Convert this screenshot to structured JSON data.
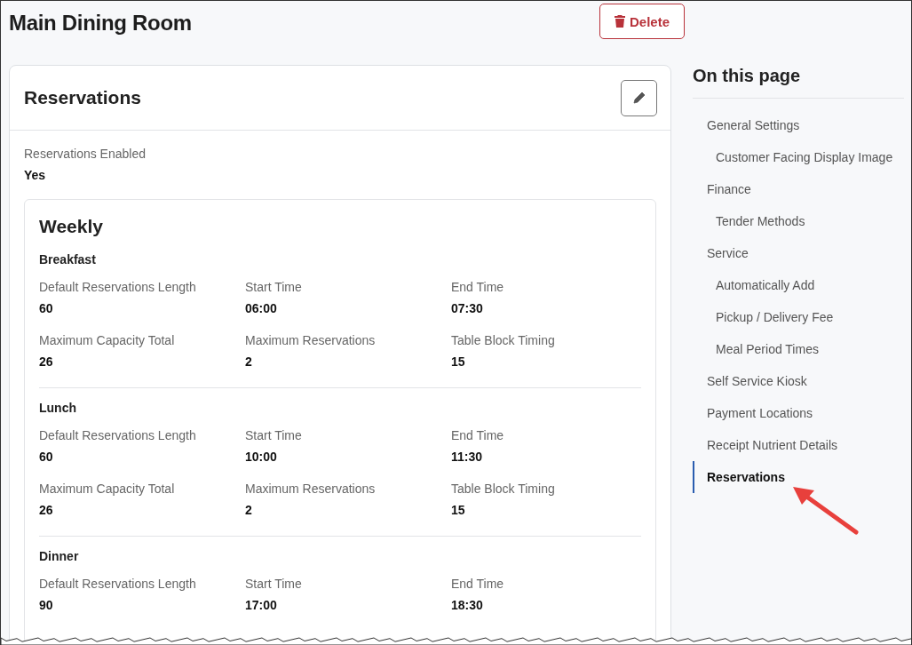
{
  "page": {
    "title": "Main Dining Room",
    "delete_button": "Delete"
  },
  "card": {
    "title": "Reservations",
    "fields": [
      {
        "label": "Reservations Enabled",
        "value": "Yes"
      }
    ],
    "weekly": {
      "title": "Weekly",
      "periods": [
        {
          "name": "Breakfast",
          "fields": [
            {
              "label": "Default Reservations Length",
              "value": "60"
            },
            {
              "label": "Start Time",
              "value": "06:00"
            },
            {
              "label": "End Time",
              "value": "07:30"
            },
            {
              "label": "Maximum Capacity Total",
              "value": "26"
            },
            {
              "label": "Maximum Reservations",
              "value": "2"
            },
            {
              "label": "Table Block Timing",
              "value": "15"
            }
          ]
        },
        {
          "name": "Lunch",
          "fields": [
            {
              "label": "Default Reservations Length",
              "value": "60"
            },
            {
              "label": "Start Time",
              "value": "10:00"
            },
            {
              "label": "End Time",
              "value": "11:30"
            },
            {
              "label": "Maximum Capacity Total",
              "value": "26"
            },
            {
              "label": "Maximum Reservations",
              "value": "2"
            },
            {
              "label": "Table Block Timing",
              "value": "15"
            }
          ]
        },
        {
          "name": "Dinner",
          "fields": [
            {
              "label": "Default Reservations Length",
              "value": "90"
            },
            {
              "label": "Start Time",
              "value": "17:00"
            },
            {
              "label": "End Time",
              "value": "18:30"
            }
          ]
        }
      ]
    }
  },
  "sidebar": {
    "title": "On this page",
    "items": [
      {
        "label": "General Settings",
        "selected": false,
        "children": [
          {
            "label": "Customer Facing Display Image",
            "selected": false
          }
        ]
      },
      {
        "label": "Finance",
        "selected": false,
        "children": [
          {
            "label": "Tender Methods",
            "selected": false
          }
        ]
      },
      {
        "label": "Service",
        "selected": false,
        "children": [
          {
            "label": "Automatically Add",
            "selected": false
          },
          {
            "label": "Pickup / Delivery Fee",
            "selected": false
          },
          {
            "label": "Meal Period Times",
            "selected": false
          }
        ]
      },
      {
        "label": "Self Service Kiosk",
        "selected": false
      },
      {
        "label": "Payment Locations",
        "selected": false
      },
      {
        "label": "Receipt Nutrient Details",
        "selected": false
      },
      {
        "label": "Reservations",
        "selected": true
      }
    ]
  }
}
